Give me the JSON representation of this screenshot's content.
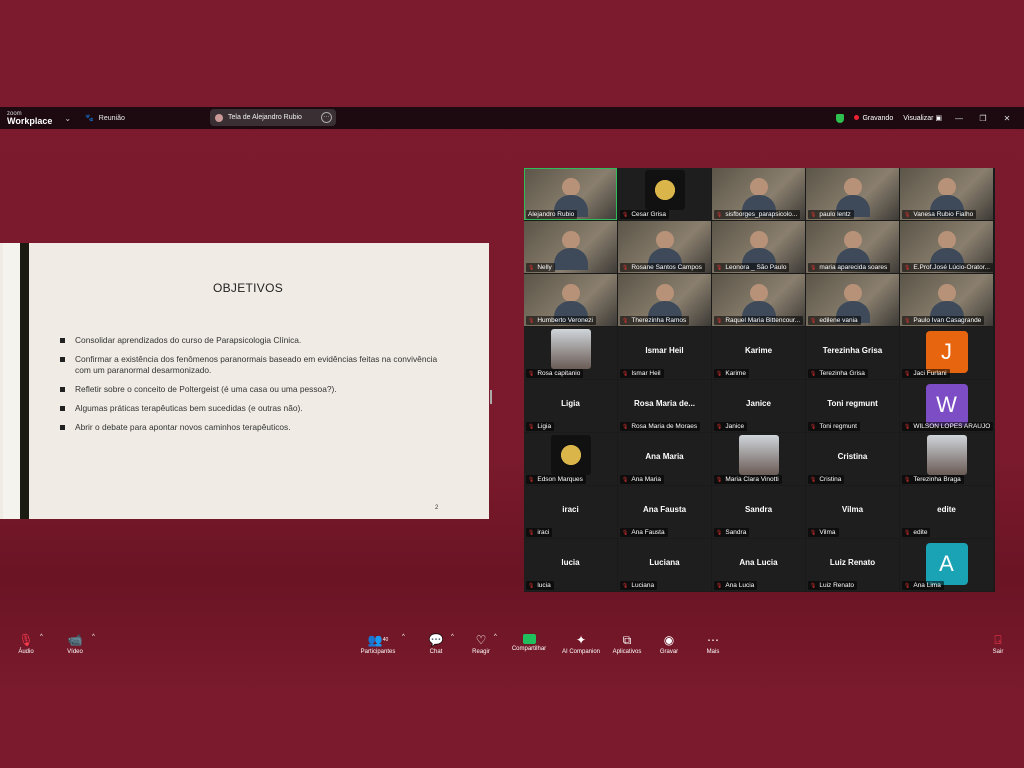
{
  "titlebar": {
    "logo_top": "zoom",
    "logo_bottom": "Workplace",
    "meeting_label": "Reunião",
    "share_label": "Tela de Alejandro Rubio",
    "recording_label": "Gravando",
    "view_label": "Visualizar"
  },
  "slide": {
    "title": "OBJETIVOS",
    "bullets": [
      "Consolidar aprendizados do curso de Parapsicologia Clínica.",
      "Confirmar a existência dos fenômenos paranormais baseado em evidências feitas na convivência com um paranormal desarmonizado.",
      "Refletir sobre o conceito de Poltergeist (é uma casa ou uma pessoa?).",
      "Algumas práticas terapêuticas bem sucedidas (e outras não).",
      "Abrir o debate para apontar novos caminhos terapêuticos."
    ],
    "page_number": "2"
  },
  "participants": [
    {
      "label": "Alejandro Rubio",
      "kind": "video",
      "active": true
    },
    {
      "label": "Cesar Grisa",
      "kind": "gold"
    },
    {
      "label": "sisfborges_parapsicolo...",
      "kind": "video"
    },
    {
      "label": "paulo lentz",
      "kind": "video"
    },
    {
      "label": "Vanesa Rubio Fialho",
      "kind": "video"
    },
    {
      "label": "Nelly",
      "kind": "video"
    },
    {
      "label": "Rosane Santos Campos",
      "kind": "video"
    },
    {
      "label": "Leonora _ São Paulo",
      "kind": "video"
    },
    {
      "label": "maria aparecida soares",
      "kind": "video"
    },
    {
      "label": "E.Prof.José Lúcio-Orator...",
      "kind": "video"
    },
    {
      "label": "Humberto Veronezi",
      "kind": "video"
    },
    {
      "label": "Therezinha Ramos",
      "kind": "video"
    },
    {
      "label": "Raquel Maria Bittencour...",
      "kind": "video"
    },
    {
      "label": "edilene vania",
      "kind": "video"
    },
    {
      "label": "Paulo Ivan Casagrande",
      "kind": "video"
    },
    {
      "label": "Rosa capitanio",
      "kind": "photo"
    },
    {
      "label": "Ismar Heil",
      "kind": "name",
      "display": "Ismar Heil"
    },
    {
      "label": "Karime",
      "kind": "name",
      "display": "Karime"
    },
    {
      "label": "Terezinha Grisa",
      "kind": "name",
      "display": "Terezinha Grisa"
    },
    {
      "label": "Jaci Furlani",
      "kind": "letter",
      "letter": "J",
      "color": "#e8650f"
    },
    {
      "label": "Ligia",
      "kind": "name",
      "display": "Ligia"
    },
    {
      "label": "Rosa Maria de Moraes",
      "kind": "name",
      "display": "Rosa Maria de..."
    },
    {
      "label": "Janice",
      "kind": "name",
      "display": "Janice"
    },
    {
      "label": "Toni regmunt",
      "kind": "name",
      "display": "Toni regmunt"
    },
    {
      "label": "WILSON LOPES ARAUJO",
      "kind": "letter",
      "letter": "W",
      "color": "#7c4dc4"
    },
    {
      "label": "Edson Marques",
      "kind": "gold"
    },
    {
      "label": "Ana Maria",
      "kind": "name",
      "display": "Ana Maria"
    },
    {
      "label": "Maria Clara Vinotti",
      "kind": "photo"
    },
    {
      "label": "Cristina",
      "kind": "name",
      "display": "Cristina"
    },
    {
      "label": "Terezinha Braga",
      "kind": "photo"
    },
    {
      "label": "iraci",
      "kind": "name",
      "display": "iraci"
    },
    {
      "label": "Ana Fausta",
      "kind": "name",
      "display": "Ana Fausta"
    },
    {
      "label": "Sandra",
      "kind": "name",
      "display": "Sandra"
    },
    {
      "label": "Vilma",
      "kind": "name",
      "display": "Vilma"
    },
    {
      "label": "edite",
      "kind": "name",
      "display": "edite"
    },
    {
      "label": "lucia",
      "kind": "name",
      "display": "lucia"
    },
    {
      "label": "Luciana",
      "kind": "name",
      "display": "Luciana"
    },
    {
      "label": "Ana Lucia",
      "kind": "name",
      "display": "Ana Lucia"
    },
    {
      "label": "Luiz Renato",
      "kind": "name",
      "display": "Luiz Renato"
    },
    {
      "label": "Ana Lima",
      "kind": "letter",
      "letter": "A",
      "color": "#1aa3b5"
    }
  ],
  "toolbar": {
    "audio": "Áudio",
    "video": "Vídeo",
    "participants": "Participantes",
    "participants_count": "40",
    "chat": "Chat",
    "react": "Reagir",
    "share": "Compartilhar",
    "ai": "AI Companion",
    "apps": "Aplicativos",
    "record": "Gravar",
    "more": "Mais",
    "leave": "Sair"
  }
}
